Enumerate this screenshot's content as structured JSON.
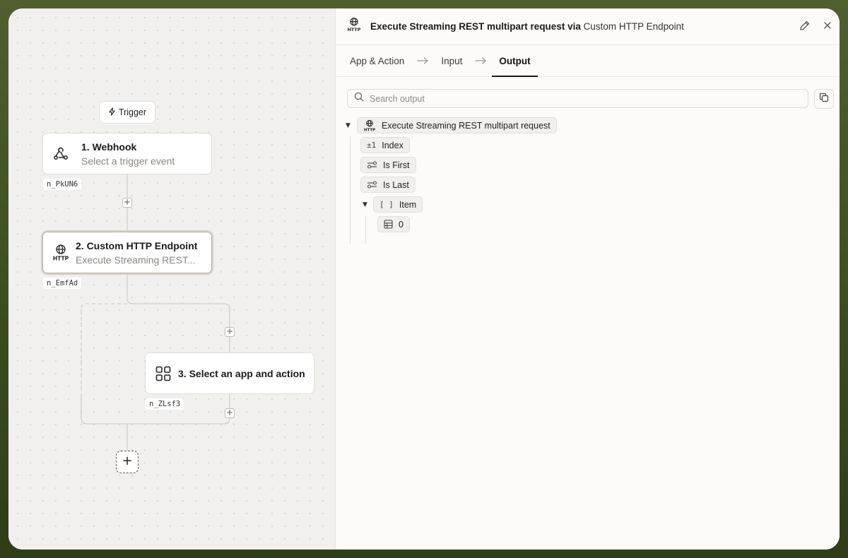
{
  "canvas": {
    "trigger_pill": {
      "label": "Trigger"
    },
    "nodes": [
      {
        "title": "1. Webhook",
        "subtitle": "Select a trigger event",
        "id_tag": "n_PkUN6",
        "icon": "webhook-icon"
      },
      {
        "title": "2. Custom HTTP Endpoint",
        "subtitle": "Execute Streaming REST...",
        "id_tag": "n_EmfAd",
        "icon": "http-icon",
        "selected": true
      },
      {
        "title": "3. Select an app and action",
        "id_tag": "n_ZLsf3",
        "icon": "apps-grid-icon"
      }
    ],
    "add_step_label": "+"
  },
  "panel": {
    "title_action": "Execute Streaming REST multipart request via",
    "title_app": "Custom HTTP Endpoint",
    "tabs": [
      {
        "label": "App & Action",
        "active": false
      },
      {
        "label": "Input",
        "active": false
      },
      {
        "label": "Output",
        "active": true
      }
    ],
    "search": {
      "placeholder": "Search output",
      "value": ""
    },
    "tree": {
      "root": {
        "label": "Execute Streaming REST multipart request",
        "icon": "http-icon",
        "expanded": true
      },
      "fields": [
        {
          "label": "Index",
          "type_icon": "±1"
        },
        {
          "label": "Is First",
          "type_icon": "toggle-icon"
        },
        {
          "label": "Is Last",
          "type_icon": "toggle-icon"
        },
        {
          "label": "Item",
          "type_icon": "[ ]",
          "expanded": true,
          "children": [
            {
              "label": "0",
              "type_icon": "table-icon"
            }
          ]
        }
      ]
    }
  },
  "colors": {
    "frame_bg": "#4a5a2a",
    "canvas_bg": "#f1f0ee",
    "panel_bg": "#fcfbfa",
    "accent": "#1a1a1a"
  }
}
